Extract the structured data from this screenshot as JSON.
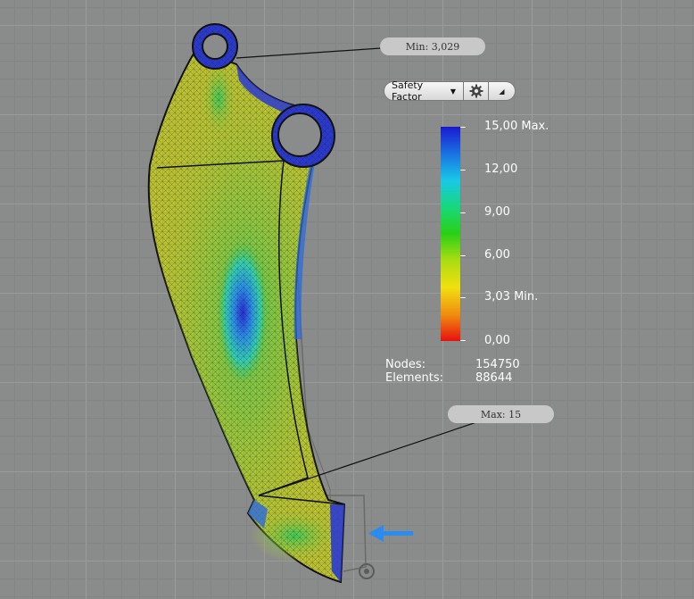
{
  "probes": {
    "min_label": "Min: 3,029",
    "max_label": "Max: 15"
  },
  "toolbar": {
    "result_type": "Safety Factor",
    "settings_icon": "gear-icon",
    "collapse_icon": "triangle-icon"
  },
  "legend": {
    "colors": [
      "#1a1ad0",
      "#19c8e8",
      "#2ad015",
      "#f0e010",
      "#e81010"
    ],
    "labels": [
      "15,00 Max.",
      "12,00",
      "9,00",
      "6,00",
      "3,03 Min.",
      "0,00"
    ]
  },
  "stats": {
    "nodes_label": "Nodes:",
    "nodes_value": "154750",
    "elements_label": "Elements:",
    "elements_value": "88644"
  }
}
